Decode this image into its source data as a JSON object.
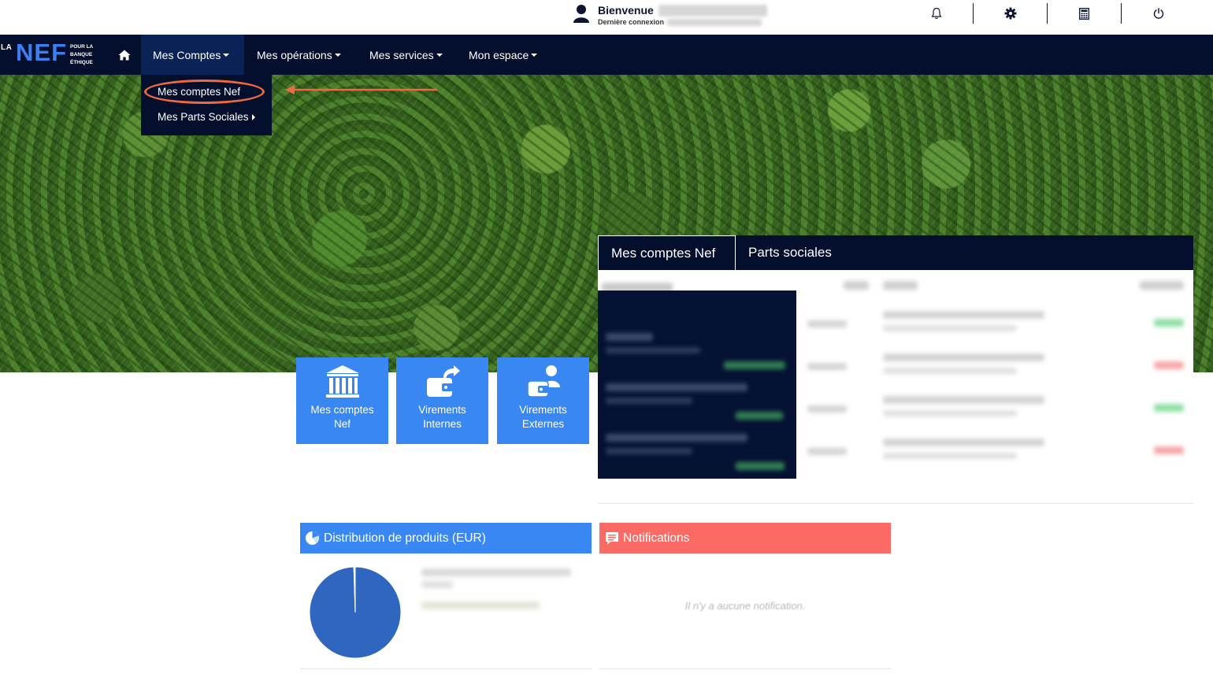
{
  "topbar": {
    "welcome_label": "Bienvenue",
    "last_login_label": "Dernière connexion",
    "icons": [
      "bell-icon",
      "gear-icon",
      "calculator-icon",
      "power-icon"
    ]
  },
  "logo": {
    "prefix": "LA",
    "brand": "NEF",
    "tagline": [
      "POUR LA",
      "BANQUE",
      "ÉTHIQUE"
    ]
  },
  "nav": {
    "items": [
      {
        "label": "Mes Comptes",
        "active": true
      },
      {
        "label": "Mes opérations",
        "active": false
      },
      {
        "label": "Mes services",
        "active": false
      },
      {
        "label": "Mon espace",
        "active": false
      }
    ]
  },
  "dropdown": {
    "items": [
      {
        "label": "Mes comptes Nef",
        "highlighted": true
      },
      {
        "label": "Mes Parts Sociales",
        "has_submenu": true
      }
    ]
  },
  "tiles": [
    {
      "label_line1": "Mes comptes",
      "label_line2": "Nef",
      "icon": "bank-icon"
    },
    {
      "label_line1": "Virements",
      "label_line2": "Internes",
      "icon": "wallet-transfer-icon"
    },
    {
      "label_line1": "Virements",
      "label_line2": "Externes",
      "icon": "wallet-user-icon"
    }
  ],
  "accounts_panel": {
    "tabs": [
      {
        "label": "Mes comptes Nef",
        "active": true
      },
      {
        "label": "Parts sociales",
        "active": false
      }
    ]
  },
  "distribution": {
    "title": "Distribution de produits (EUR)",
    "header_color": "#3987f2"
  },
  "chart_data": {
    "type": "pie",
    "slices": [
      {
        "value": 99.5,
        "color": "#2f66c0"
      },
      {
        "value": 0.5,
        "color": "#ffffff"
      }
    ]
  },
  "notifications": {
    "title": "Notifications",
    "header_color": "#fb6b64",
    "empty_text": "Il n'y a aucune notification."
  },
  "colors": {
    "navy": "#030f2d",
    "active_nav": "#0a2356",
    "accent_blue": "#3987f2",
    "highlight_orange": "#ec6a3d"
  }
}
